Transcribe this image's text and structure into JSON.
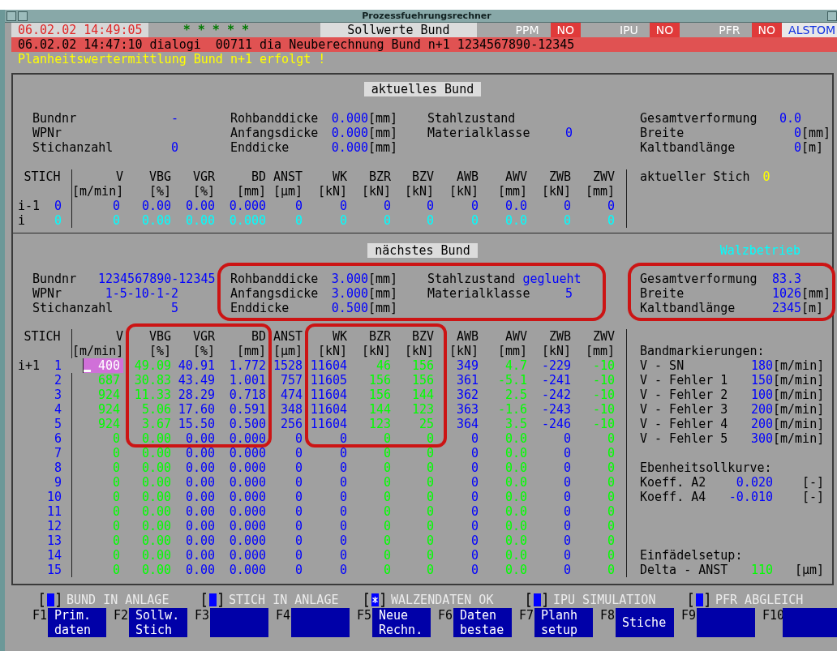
{
  "window": {
    "title": "Prozessfuehrungsrechner"
  },
  "header": {
    "datetime": "06.02.02 14:49:05",
    "stars": "* * * * *",
    "screen_title": "Sollwerte Bund",
    "status": [
      {
        "label": "PPM",
        "value": "NO"
      },
      {
        "label": "IPU",
        "value": "NO"
      },
      {
        "label": "PFR",
        "value": "NO"
      }
    ],
    "brand": "ALSTOM"
  },
  "message": "06.02.02 14:47:10 dialogi  00711 dia Neuberechnung Bund n+1 1234567890-12345",
  "info": "Planheitswertermittlung Bund n+1 erfolgt !",
  "current": {
    "title": "aktuelles Bund",
    "fields": [
      [
        {
          "label": "Bundnr",
          "value": "-"
        },
        {
          "label": "WPNr"
        },
        {
          "label": "Stichanzahl",
          "value": "0"
        }
      ],
      [
        {
          "label": "Rohbanddicke",
          "value": "0.000",
          "unit": "[mm]"
        },
        {
          "label": "Anfangsdicke",
          "value": "0.000",
          "unit": "[mm]"
        },
        {
          "label": "Enddicke",
          "value": "0.000",
          "unit": "[mm]"
        }
      ],
      [
        {
          "label": "Stahlzustand"
        },
        {
          "label": "Materialklasse",
          "value": "0"
        }
      ],
      [
        {
          "label": "Gesamtverformung",
          "value": "0.0"
        },
        {
          "label": "Breite",
          "value": "0",
          "unit": "[mm]"
        },
        {
          "label": "Kaltbandlänge",
          "value": "0",
          "unit": "[m]"
        }
      ]
    ],
    "table": {
      "stich_header": "STICH",
      "columns": [
        {
          "header": "V",
          "unit": "[m/min]"
        },
        {
          "header": "VBG",
          "unit": "[%]"
        },
        {
          "header": "VGR",
          "unit": "[%]"
        },
        {
          "header": "BD",
          "unit": "[mm]"
        },
        {
          "header": "ANST",
          "unit": "[µm]"
        },
        {
          "header": "WK",
          "unit": "[kN]"
        },
        {
          "header": "BZR",
          "unit": "[kN]"
        },
        {
          "header": "BZV",
          "unit": "[kN]"
        },
        {
          "header": "AWB",
          "unit": "[kN]"
        },
        {
          "header": "AWV",
          "unit": "[mm]"
        },
        {
          "header": "ZWB",
          "unit": "[kN]"
        },
        {
          "header": "ZWV",
          "unit": "[mm]"
        }
      ],
      "rows": [
        {
          "label": "i-1",
          "stich": "0",
          "color": "#0000ff",
          "cells": [
            "0",
            "0.00",
            "0.00",
            "0.000",
            "0",
            "0",
            "0",
            "0",
            "0",
            "0.0",
            "0",
            "0"
          ]
        },
        {
          "label": "i",
          "stich": "0",
          "color": "#00ffff",
          "cells": [
            "0",
            "0.00",
            "0.00",
            "0.000",
            "0",
            "0",
            "0",
            "0",
            "0",
            "0.0",
            "0",
            "0"
          ]
        }
      ]
    },
    "side": {
      "label": "aktueller Stich",
      "value": "0"
    }
  },
  "next": {
    "title": "nächstes Bund",
    "mode": "Walzbetrieb",
    "fields": [
      [
        {
          "label": "Bundnr",
          "value": "1234567890-12345"
        },
        {
          "label": "WPNr",
          "value": "1-5-10-1-2"
        },
        {
          "label": "Stichanzahl",
          "value": "5"
        }
      ],
      [
        {
          "label": "Rohbanddicke",
          "value": "3.000",
          "unit": "[mm]"
        },
        {
          "label": "Anfangsdicke",
          "value": "3.000",
          "unit": "[mm]"
        },
        {
          "label": "Enddicke",
          "value": "0.500",
          "unit": "[mm]"
        }
      ],
      [
        {
          "label": "Stahlzustand",
          "value": "geglueht"
        },
        {
          "label": "Materialklasse",
          "value": "5"
        }
      ],
      [
        {
          "label": "Gesamtverformung",
          "value": "83.3"
        },
        {
          "label": "Breite",
          "value": "1026",
          "unit": "[mm]"
        },
        {
          "label": "Kaltbandlänge",
          "value": "2345",
          "unit": "[m]"
        }
      ]
    ],
    "table": {
      "stich_header": "STICH",
      "stich_column": {
        "color": "#0000ff"
      },
      "columns": [
        {
          "header": "V",
          "unit": "[m/min]",
          "color": "#00ff00"
        },
        {
          "header": "VBG",
          "unit": "[%]",
          "color": "#00ff00"
        },
        {
          "header": "VGR",
          "unit": "[%]",
          "color": "#0000ff"
        },
        {
          "header": "BD",
          "unit": "[mm]",
          "color": "#0000ff"
        },
        {
          "header": "ANST",
          "unit": "[µm]",
          "color": "#0000ff"
        },
        {
          "header": "WK",
          "unit": "[kN]",
          "color": "#0000ff"
        },
        {
          "header": "BZR",
          "unit": "[kN]",
          "color": "#00ff00"
        },
        {
          "header": "BZV",
          "unit": "[kN]",
          "color": "#00ff00"
        },
        {
          "header": "AWB",
          "unit": "[kN]",
          "color": "#0000ff"
        },
        {
          "header": "AWV",
          "unit": "[mm]",
          "color": "#00ff00"
        },
        {
          "header": "ZWB",
          "unit": "[kN]",
          "color": "#0000ff"
        },
        {
          "header": "ZWV",
          "unit": "[mm]",
          "color": "#00ff00"
        }
      ],
      "rows": [
        {
          "label": "i+1",
          "stich": "1",
          "cursor": true,
          "cells": [
            "400",
            "49.09",
            "40.91",
            "1.772",
            "1528",
            "11604",
            "46",
            "156",
            "349",
            "4.7",
            "-229",
            "-10"
          ]
        },
        {
          "stich": "2",
          "cursor": false,
          "cells": [
            "687",
            "30.83",
            "43.49",
            "1.001",
            "757",
            "11605",
            "156",
            "156",
            "361",
            "-5.1",
            "-241",
            "-10"
          ]
        },
        {
          "stich": "3",
          "cursor": false,
          "cells": [
            "924",
            "11.33",
            "28.29",
            "0.718",
            "474",
            "11604",
            "156",
            "144",
            "362",
            "2.5",
            "-242",
            "-10"
          ]
        },
        {
          "stich": "4",
          "cursor": false,
          "cells": [
            "924",
            "5.06",
            "17.60",
            "0.591",
            "348",
            "11604",
            "144",
            "123",
            "363",
            "-1.6",
            "-243",
            "-10"
          ]
        },
        {
          "stich": "5",
          "cursor": false,
          "cells": [
            "924",
            "3.67",
            "15.50",
            "0.500",
            "256",
            "11604",
            "123",
            "25",
            "364",
            "3.5",
            "-246",
            "-10"
          ]
        },
        {
          "stich": "6",
          "cursor": false,
          "cells": [
            "0",
            "0.00",
            "0.00",
            "0.000",
            "0",
            "0",
            "0",
            "0",
            "0",
            "0.0",
            "0",
            "0"
          ]
        },
        {
          "stich": "7",
          "cursor": false,
          "cells": [
            "0",
            "0.00",
            "0.00",
            "0.000",
            "0",
            "0",
            "0",
            "0",
            "0",
            "0.0",
            "0",
            "0"
          ]
        },
        {
          "stich": "8",
          "cursor": false,
          "cells": [
            "0",
            "0.00",
            "0.00",
            "0.000",
            "0",
            "0",
            "0",
            "0",
            "0",
            "0.0",
            "0",
            "0"
          ]
        },
        {
          "stich": "9",
          "cursor": false,
          "cells": [
            "0",
            "0.00",
            "0.00",
            "0.000",
            "0",
            "0",
            "0",
            "0",
            "0",
            "0.0",
            "0",
            "0"
          ]
        },
        {
          "stich": "10",
          "cursor": false,
          "cells": [
            "0",
            "0.00",
            "0.00",
            "0.000",
            "0",
            "0",
            "0",
            "0",
            "0",
            "0.0",
            "0",
            "0"
          ]
        },
        {
          "stich": "11",
          "cursor": false,
          "cells": [
            "0",
            "0.00",
            "0.00",
            "0.000",
            "0",
            "0",
            "0",
            "0",
            "0",
            "0.0",
            "0",
            "0"
          ]
        },
        {
          "stich": "12",
          "cursor": false,
          "cells": [
            "0",
            "0.00",
            "0.00",
            "0.000",
            "0",
            "0",
            "0",
            "0",
            "0",
            "0.0",
            "0",
            "0"
          ]
        },
        {
          "stich": "13",
          "cursor": false,
          "cells": [
            "0",
            "0.00",
            "0.00",
            "0.000",
            "0",
            "0",
            "0",
            "0",
            "0",
            "0.0",
            "0",
            "0"
          ]
        },
        {
          "stich": "14",
          "cursor": false,
          "cells": [
            "0",
            "0.00",
            "0.00",
            "0.000",
            "0",
            "0",
            "0",
            "0",
            "0",
            "0.0",
            "0",
            "0"
          ]
        },
        {
          "stich": "15",
          "cursor": false,
          "cells": [
            "0",
            "0.00",
            "0.00",
            "0.000",
            "0",
            "0",
            "0",
            "0",
            "0",
            "0.0",
            "0",
            "0"
          ]
        }
      ]
    },
    "side_groups": [
      {
        "title": "Bandmarkierungen:",
        "items": [
          {
            "label": "V - SN",
            "value": "180",
            "unit": "[m/min]",
            "color": "#0000ff"
          },
          {
            "label": "V - Fehler 1",
            "value": "150",
            "unit": "[m/min]",
            "color": "#0000ff"
          },
          {
            "label": "V - Fehler 2",
            "value": "100",
            "unit": "[m/min]",
            "color": "#0000ff"
          },
          {
            "label": "V - Fehler 3",
            "value": "200",
            "unit": "[m/min]",
            "color": "#0000ff"
          },
          {
            "label": "V - Fehler 4",
            "value": "200",
            "unit": "[m/min]",
            "color": "#0000ff"
          },
          {
            "label": "V - Fehler 5",
            "value": "300",
            "unit": "[m/min]",
            "color": "#0000ff"
          }
        ]
      },
      {
        "title": "Ebenheitsollkurve:",
        "items": [
          {
            "label": "Koeff. A2",
            "value": "0.020",
            "unit": "[-]",
            "color": "#0000ff"
          },
          {
            "label": "Koeff. A4",
            "value": "-0.010",
            "unit": "[-]",
            "color": "#0000ff"
          }
        ]
      },
      {
        "title": "Einfädelsetup:",
        "items": [
          {
            "label": "Delta - ANST",
            "value": "110",
            "unit": "[µm]",
            "color": "#00ff00"
          }
        ]
      }
    ]
  },
  "checkboxes": [
    {
      "label": "BUND IN ANLAGE",
      "checked": false
    },
    {
      "label": "STICH IN ANLAGE",
      "checked": false
    },
    {
      "label": "WALZENDATEN OK",
      "checked": true
    },
    {
      "label": "IPU SIMULATION",
      "checked": false
    },
    {
      "label": "PFR ABGLEICH",
      "checked": false
    }
  ],
  "function_keys": [
    {
      "key": "F1",
      "label": "Prim.\ndaten"
    },
    {
      "key": "F2",
      "label": "Sollw.\nStich"
    },
    {
      "key": "F3"
    },
    {
      "key": "F4"
    },
    {
      "key": "F5",
      "label": "Neue\nRechn."
    },
    {
      "key": "F6",
      "label": "Daten\nbestae"
    },
    {
      "key": "F7",
      "label": "Planh\nsetup"
    },
    {
      "key": "F8",
      "label": "Stiche"
    },
    {
      "key": "F9"
    },
    {
      "key": "F10"
    }
  ]
}
